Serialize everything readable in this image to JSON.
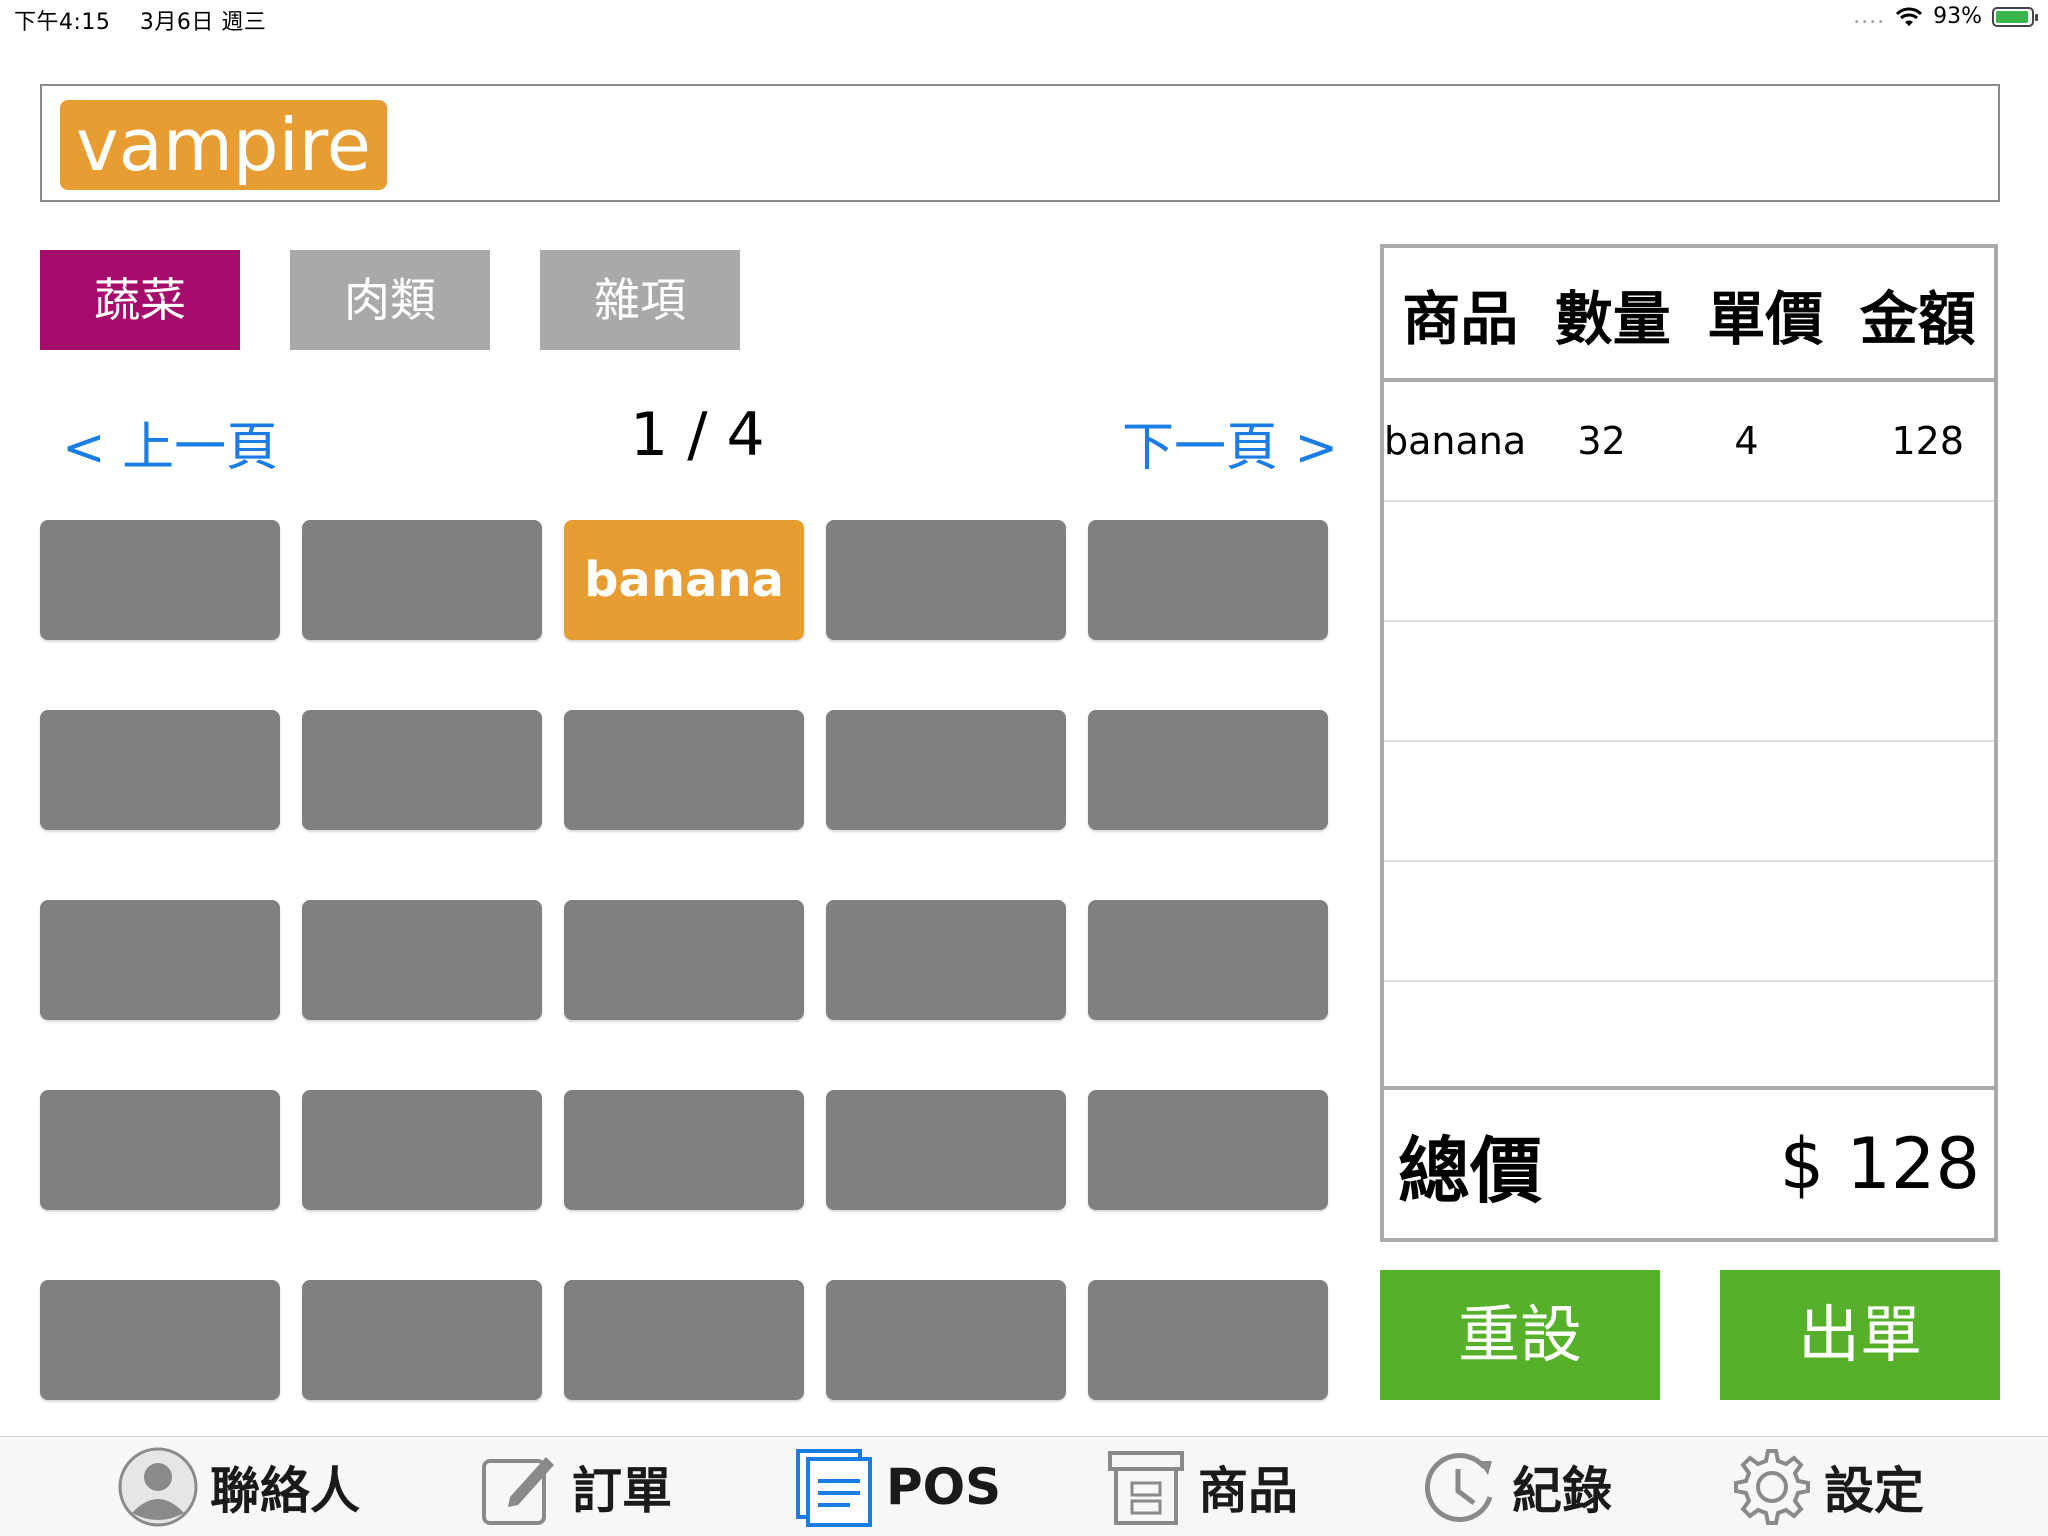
{
  "status_bar": {
    "time": "下午4:15",
    "date": "3月6日 週三",
    "signal": "....",
    "battery_percent": "93%",
    "battery_level": 0.93
  },
  "search": {
    "token": "vampire"
  },
  "categories": [
    {
      "label": "蔬菜",
      "active": true
    },
    {
      "label": "肉類",
      "active": false
    },
    {
      "label": "雜項",
      "active": false
    }
  ],
  "pager": {
    "prev": "< 上一頁",
    "next": "下一頁 >",
    "count": "1 / 4"
  },
  "products": [
    "",
    "",
    "banana",
    "",
    "",
    "",
    "",
    "",
    "",
    "",
    "",
    "",
    "",
    "",
    "",
    "",
    "",
    "",
    "",
    "",
    "",
    "",
    "",
    "",
    ""
  ],
  "order": {
    "headers": {
      "name": "商品",
      "qty": "數量",
      "price": "單價",
      "amount": "金額"
    },
    "rows": [
      {
        "name": "banana",
        "qty": "32",
        "price": "4",
        "amount": "128"
      },
      {
        "name": "",
        "qty": "",
        "price": "",
        "amount": ""
      },
      {
        "name": "",
        "qty": "",
        "price": "",
        "amount": ""
      },
      {
        "name": "",
        "qty": "",
        "price": "",
        "amount": ""
      },
      {
        "name": "",
        "qty": "",
        "price": "",
        "amount": ""
      },
      {
        "name": "",
        "qty": "",
        "price": "",
        "amount": ""
      }
    ],
    "total_label": "總價",
    "total_value": "$ 128"
  },
  "actions": {
    "reset": "重設",
    "checkout": "出單"
  },
  "tabbar": [
    {
      "label": "聯絡人",
      "icon": "contact-icon"
    },
    {
      "label": "訂單",
      "icon": "edit-icon"
    },
    {
      "label": "POS",
      "icon": "pos-icon"
    },
    {
      "label": "商品",
      "icon": "archive-icon"
    },
    {
      "label": "紀錄",
      "icon": "history-icon"
    },
    {
      "label": "設定",
      "icon": "gear-icon"
    }
  ],
  "colors": {
    "category_active": "#a50b6a",
    "category_inactive": "#a9a9a9",
    "selected_tile": "#e89d33",
    "tile": "#808080",
    "action_green": "#56b02a",
    "link_blue": "#1a7de6"
  }
}
